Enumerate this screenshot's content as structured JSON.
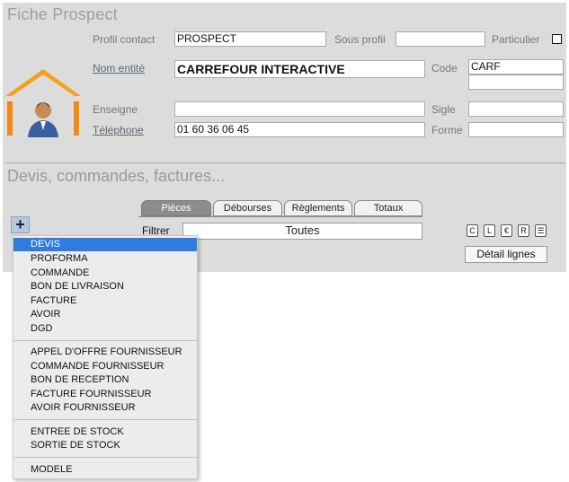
{
  "form": {
    "title": "Fiche  Prospect",
    "profil_label": "Profil contact",
    "profil_value": "PROSPECT",
    "sous_profil_label": "Sous profil",
    "sous_profil_value": "",
    "particulier_label": "Particulier",
    "particulier_checked": false,
    "nom_label": "Nom entité",
    "nom_value": "CARREFOUR INTERACTIVE",
    "code_label": "Code",
    "code_value": "CARF",
    "code_value2": "",
    "enseigne_label": "Enseigne",
    "enseigne_value": "",
    "sigle_label": "Sigle",
    "sigle_value": "",
    "tel_label": "Téléphone",
    "tel_value": "01 60 36 06 45",
    "forme_label": "Forme",
    "forme_value": ""
  },
  "section": {
    "title": "Devis, commandes, factures...",
    "tabs": [
      "Pièces",
      "Débourses",
      "Règlements",
      "Totaux"
    ],
    "active_tab": "Pièces",
    "add_label": "+",
    "filter_label": "Filtrer",
    "filter_value": "Toutes",
    "mini_buttons": [
      "C",
      "L",
      "€",
      "R",
      "☰"
    ],
    "detail_button": "Détail lignes"
  },
  "menu": {
    "items": [
      "DEVIS",
      "PROFORMA",
      "COMMANDE",
      "BON DE LIVRAISON",
      "FACTURE",
      "AVOIR",
      "DGD",
      "APPEL D'OFFRE FOURNISSEUR",
      "COMMANDE FOURNISSEUR",
      "BON DE RECEPTION",
      "FACTURE FOURNISSEUR",
      "AVOIR FOURNISSEUR",
      "ENTREE DE STOCK",
      "SORTIE DE STOCK",
      "MODELE"
    ],
    "selected": "DEVIS"
  },
  "colors": {
    "accent_orange": "#f5a01a",
    "selection_blue": "#2f7bde"
  }
}
